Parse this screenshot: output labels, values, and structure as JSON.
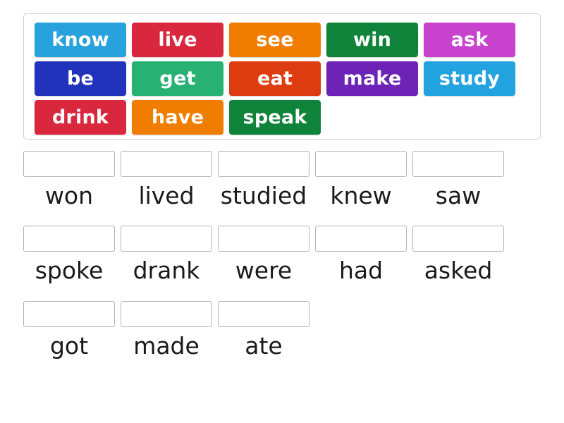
{
  "activity": {
    "type": "match-up-drag-and-drop",
    "tile_bank": {
      "rows": [
        [
          {
            "label": "know",
            "color": "#27a2dd"
          },
          {
            "label": "live",
            "color": "#d9273e"
          },
          {
            "label": "see",
            "color": "#f07d00"
          },
          {
            "label": "win",
            "color": "#10833a"
          },
          {
            "label": "ask",
            "color": "#c843cd"
          }
        ],
        [
          {
            "label": "be",
            "color": "#2233bb"
          },
          {
            "label": "get",
            "color": "#27b274"
          },
          {
            "label": "eat",
            "color": "#dd3c10"
          },
          {
            "label": "make",
            "color": "#6d23b6"
          },
          {
            "label": "study",
            "color": "#22a3e0"
          }
        ],
        [
          {
            "label": "drink",
            "color": "#d9273e"
          },
          {
            "label": "have",
            "color": "#f07d00"
          },
          {
            "label": "speak",
            "color": "#10833a"
          }
        ]
      ]
    },
    "answer_grid": {
      "rows": [
        [
          {
            "label": "won",
            "value": ""
          },
          {
            "label": "lived",
            "value": ""
          },
          {
            "label": "studied",
            "value": ""
          },
          {
            "label": "knew",
            "value": ""
          },
          {
            "label": "saw",
            "value": ""
          }
        ],
        [
          {
            "label": "spoke",
            "value": ""
          },
          {
            "label": "drank",
            "value": ""
          },
          {
            "label": "were",
            "value": ""
          },
          {
            "label": "had",
            "value": ""
          },
          {
            "label": "asked",
            "value": ""
          }
        ],
        [
          {
            "label": "got",
            "value": ""
          },
          {
            "label": "made",
            "value": ""
          },
          {
            "label": "ate",
            "value": ""
          }
        ]
      ]
    }
  },
  "colors": {
    "page_background": "#ffffff",
    "bank_border": "#d0d0d0",
    "dropzone_border": "#b5b5b5",
    "label_text": "#1a1a1a",
    "tile_text": "#ffffff"
  }
}
